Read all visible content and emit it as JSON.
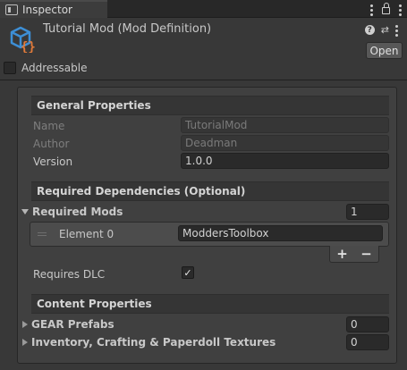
{
  "tab": {
    "label": "Inspector"
  },
  "header": {
    "title": "Tutorial Mod (Mod Definition)",
    "open_label": "Open"
  },
  "addressable": {
    "label": "Addressable",
    "checked": false
  },
  "general": {
    "heading": "General Properties",
    "name_label": "Name",
    "name_value": "TutorialMod",
    "author_label": "Author",
    "author_value": "Deadman",
    "version_label": "Version",
    "version_value": "1.0.0"
  },
  "dependencies": {
    "heading": "Required Dependencies (Optional)",
    "required_mods_label": "Required Mods",
    "required_mods_count": "1",
    "elements": [
      {
        "label": "Element 0",
        "value": "ModdersToolbox"
      }
    ],
    "add_label": "+",
    "remove_label": "−",
    "requires_dlc_label": "Requires DLC",
    "requires_dlc_checked": true
  },
  "content": {
    "heading": "Content Properties",
    "gear_label": "GEAR Prefabs",
    "gear_count": "0",
    "textures_label": "Inventory, Crafting & Paperdoll Textures",
    "textures_count": "0"
  },
  "colors": {
    "background": "#383838",
    "panel": "#404040",
    "field": "#2a2a2a",
    "cube_blue": "#3d8fd6",
    "cube_orange": "#e07a3a"
  }
}
